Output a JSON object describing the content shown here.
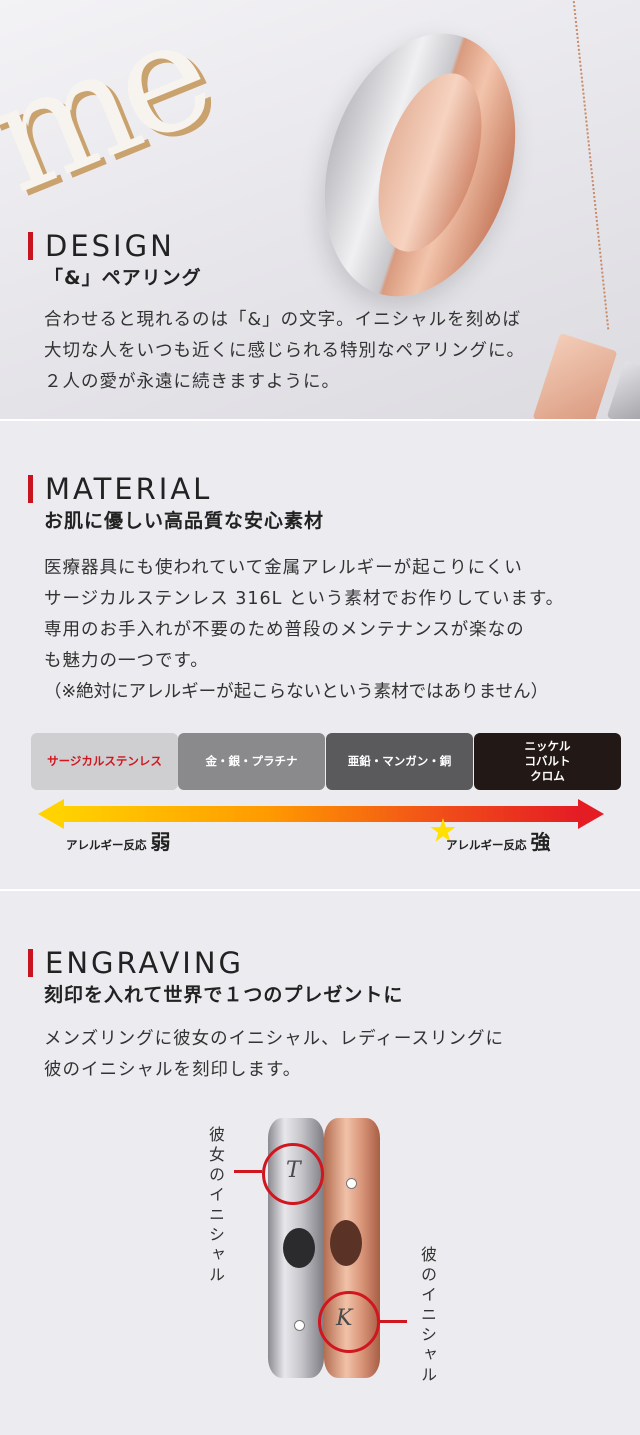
{
  "design": {
    "title": "DESIGN",
    "subtitle": "「&」ペアリング",
    "lines": [
      "合わせると現れるのは「&」の文字。イニシャルを刻めば",
      "大切な人をいつも近くに感じられる特別なペアリングに。",
      "２人の愛が永遠に続きますように。"
    ]
  },
  "material": {
    "title": "MATERIAL",
    "subtitle": "お肌に優しい高品質な安心素材",
    "lines": [
      "医療器具にも使われていて金属アレルギーが起こりにくい",
      "サージカルステンレス 316L という素材でお作りしています。",
      "専用のお手入れが不要のため普段のメンテナンスが楽なの",
      "も魅力の一つです。",
      "（※絶対にアレルギーが起こらないという素材ではありません）"
    ],
    "scale": [
      {
        "label": "サージカルステンレス",
        "bg": "#cfcfd2",
        "fg": "#d0161f"
      },
      {
        "label": "金・銀・プラチナ",
        "bg": "#8a8a8c",
        "fg": "#ffffff"
      },
      {
        "label": "亜鉛・マンガン・銅",
        "bg": "#5a5a5c",
        "fg": "#ffffff"
      },
      {
        "label": "ニッケル\nコバルト\nクロム",
        "bg": "#221816",
        "fg": "#ffffff"
      }
    ],
    "weak_label": "アレルギー反応",
    "weak_mark": "弱",
    "strong_label": "アレルギー反応",
    "strong_mark": "強"
  },
  "engraving": {
    "title": "ENGRAVING",
    "subtitle": "刻印を入れて世界で１つのプレゼントに",
    "lines": [
      "メンズリングに彼女のイニシャル、レディースリングに",
      "彼のイニシャルを刻印します。"
    ],
    "her_initial_label": "彼女のイニシャル",
    "his_initial_label": "彼のイニシャル",
    "her_initial": "T",
    "his_initial": "K"
  }
}
